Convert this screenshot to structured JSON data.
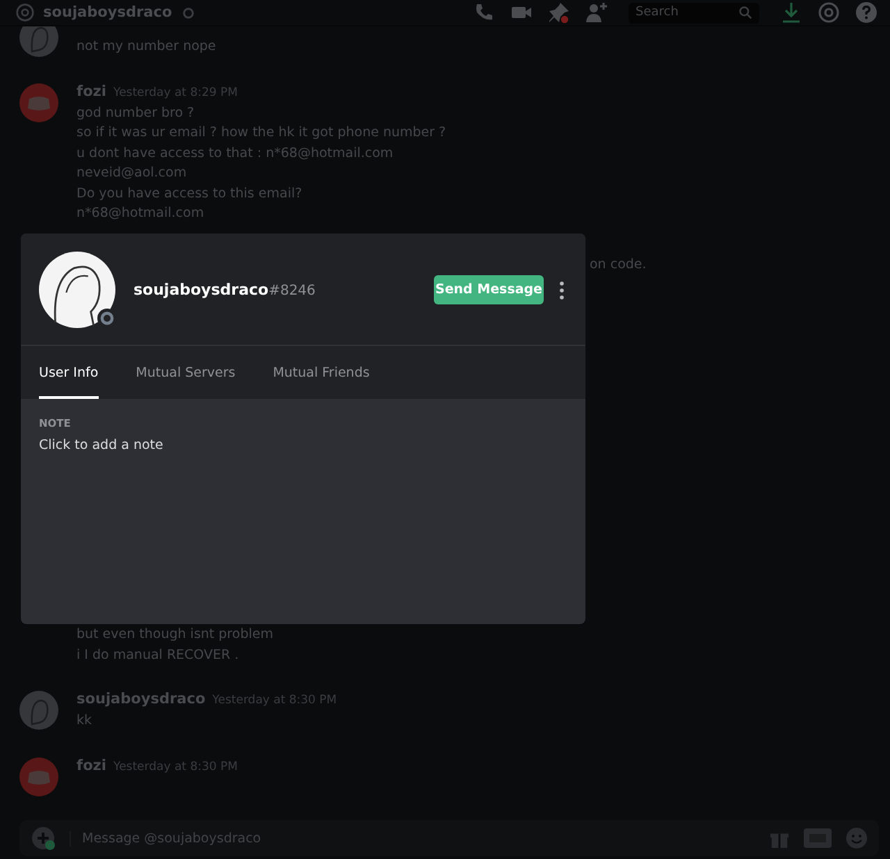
{
  "header": {
    "title": "soujaboysdraco",
    "search": {
      "placeholder": "Search"
    }
  },
  "messages_before": [
    {
      "kind": "user",
      "lines": [
        "not my number nope"
      ]
    },
    {
      "kind": "bot",
      "author": "fozi",
      "time": "Yesterday at 8:29 PM",
      "lines": [
        "god number bro ?",
        "so if it was ur email ? how the hk it got phone number ?",
        "u dont have access to that : n*68@hotmail.com",
        "neveid@aol.com",
        "Do you have access to this email?",
        "n*68@hotmail.com"
      ]
    }
  ],
  "partial_line": "on code.",
  "messages_after": [
    {
      "lines": [
        "but even though isnt problem",
        "i I do manual RECOVER ."
      ]
    },
    {
      "kind": "user",
      "author": "soujaboysdraco",
      "time": "Yesterday at 8:30 PM",
      "lines": [
        "kk"
      ]
    },
    {
      "kind": "bot",
      "author": "fozi",
      "time": "Yesterday at 8:30 PM"
    }
  ],
  "composer": {
    "placeholder": "Message @soujaboysdraco"
  },
  "profile": {
    "username": "soujaboysdraco",
    "discriminator": "#8246",
    "button": "Send Message",
    "tabs": [
      {
        "label": "User Info",
        "selected": true
      },
      {
        "label": "Mutual Servers",
        "selected": false
      },
      {
        "label": "Mutual Friends",
        "selected": false
      }
    ],
    "note": {
      "label": "NOTE",
      "placeholder": "Click to add a note"
    }
  }
}
